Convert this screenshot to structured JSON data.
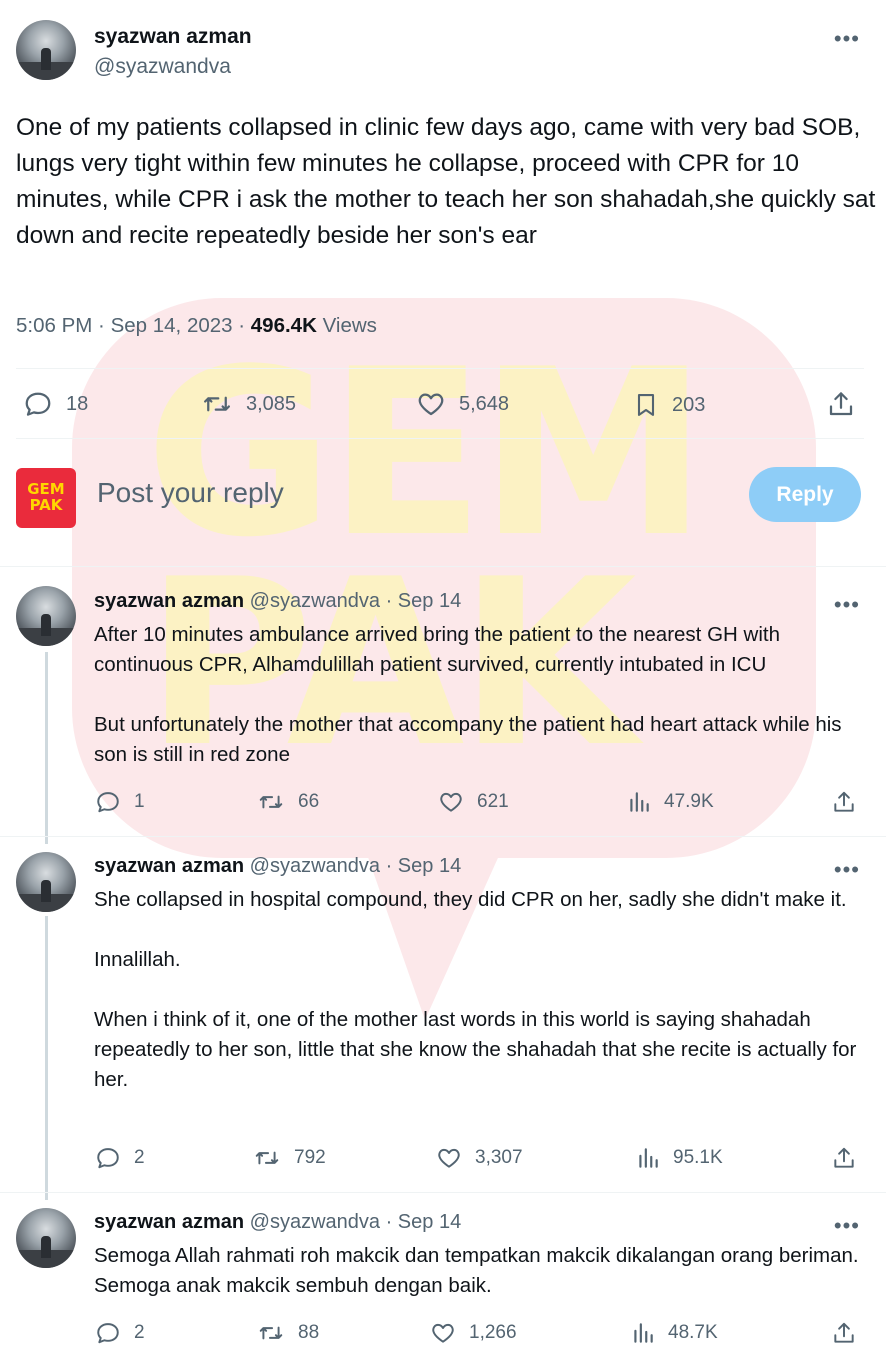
{
  "main_tweet": {
    "name": "syazwan azman",
    "handle": "@syazwandva",
    "text": "One of my patients collapsed in clinic few days ago, came with very bad SOB, lungs very tight within few minutes he collapse, proceed with CPR for 10 minutes, while CPR i ask the mother to teach her son shahadah,she quickly sat down and recite repeatedly beside her son's ear",
    "time": "5:06 PM",
    "date": "Sep 14, 2023",
    "views_count": "496.4K",
    "views_label": "Views",
    "replies": "18",
    "retweets": "3,085",
    "likes": "5,648",
    "bookmarks": "203"
  },
  "composer": {
    "logo_line1": "GEM",
    "logo_line2": "PAK",
    "placeholder": "Post your reply",
    "button_label": "Reply"
  },
  "watermark": {
    "line1": "GEM",
    "line2": "PAK"
  },
  "replies": [
    {
      "name": "syazwan azman",
      "handle": "@syazwandva",
      "date": "Sep 14",
      "paragraphs": [
        "After 10 minutes ambulance arrived  bring the patient to the nearest GH with continuous CPR, Alhamdulillah patient survived, currently intubated in ICU",
        "But unfortunately the mother that accompany the patient had heart attack while his son is still in red zone"
      ],
      "replies": "1",
      "retweets": "66",
      "likes": "621",
      "views": "47.9K"
    },
    {
      "name": "syazwan azman",
      "handle": "@syazwandva",
      "date": "Sep 14",
      "paragraphs": [
        "She collapsed in hospital compound, they did CPR on her, sadly she didn't make it.",
        "Innalillah.",
        "When i think of it, one of the mother last words in this world is saying shahadah repeatedly to her son, little that she know the shahadah that she recite is actually for her."
      ],
      "replies": "2",
      "retweets": "792",
      "likes": "3,307",
      "views": "95.1K"
    },
    {
      "name": "syazwan azman",
      "handle": "@syazwandva",
      "date": "Sep 14",
      "paragraphs": [
        "Semoga Allah rahmati roh makcik dan tempatkan makcik dikalangan orang beriman. Semoga anak makcik sembuh dengan baik."
      ],
      "replies": "2",
      "retweets": "88",
      "likes": "1,266",
      "views": "48.7K"
    }
  ],
  "more_glyph": "•••",
  "separator": " · ",
  "colors": {
    "accent": "#1d9bf0",
    "reply_button": "#8ecdf7",
    "muted": "#536471",
    "logo_bg": "#ea2b3c",
    "logo_fg": "#ffd600"
  }
}
